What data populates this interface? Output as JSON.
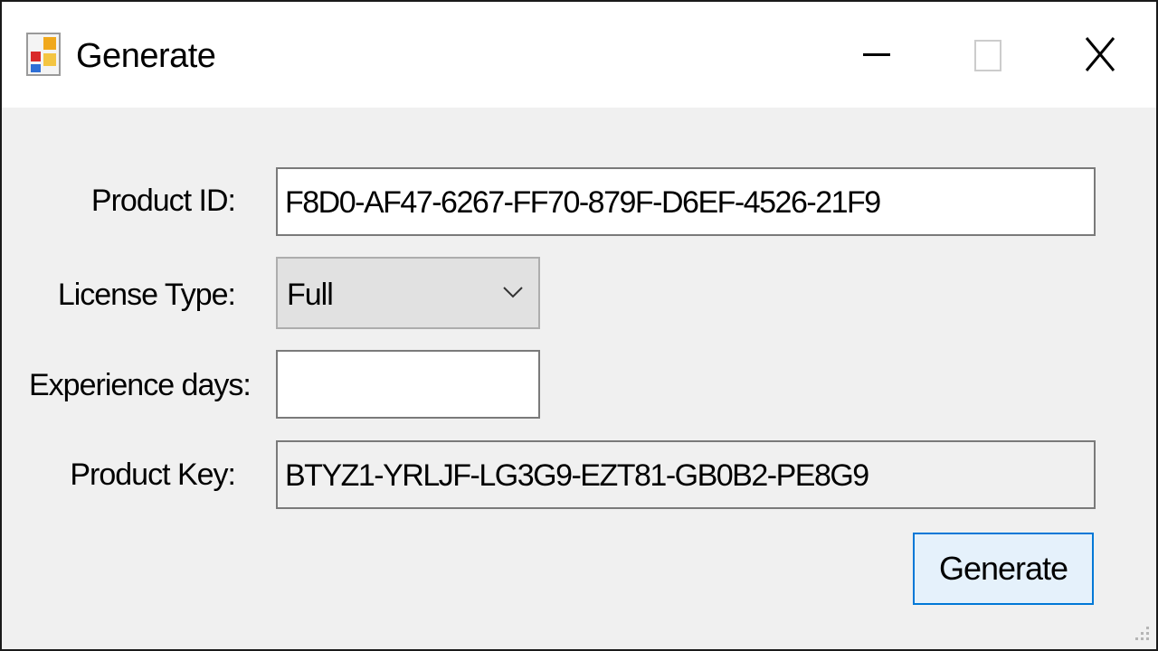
{
  "window": {
    "title": "Generate",
    "icon": "windows-form-app-icon"
  },
  "titlebar_buttons": {
    "minimize": "minimize-icon",
    "maximize": "maximize-icon",
    "close": "close-icon"
  },
  "form": {
    "product_id": {
      "label": "Product ID:",
      "value": "F8D0-AF47-6267-FF70-879F-D6EF-4526-21F9"
    },
    "license_type": {
      "label": "License Type:",
      "selected": "Full"
    },
    "experience_days": {
      "label": "Experience days:",
      "value": ""
    },
    "product_key": {
      "label": "Product Key:",
      "value": "BTYZ1-YRLJF-LG3G9-EZT81-GB0B2-PE8G9"
    },
    "generate_label": "Generate"
  },
  "colors": {
    "titlebar": "#ffffff",
    "client_area": "#f0f0f0",
    "button_focus_border": "#0078d7",
    "button_focus_fill": "#e5f1fb"
  }
}
